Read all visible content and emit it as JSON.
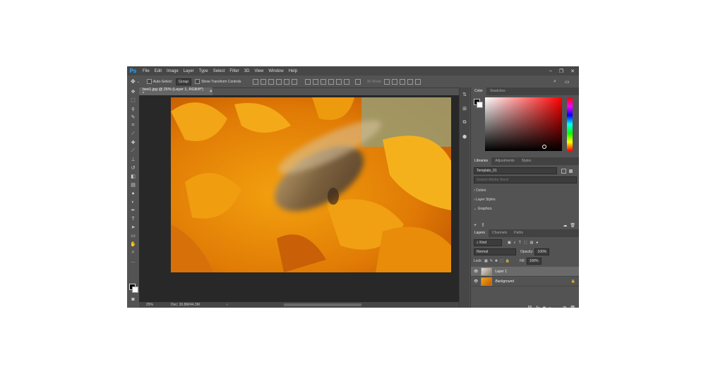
{
  "app": {
    "logo": "Ps"
  },
  "menu": [
    "File",
    "Edit",
    "Image",
    "Layer",
    "Type",
    "Select",
    "Filter",
    "3D",
    "View",
    "Window",
    "Help"
  ],
  "window_controls": [
    "minimize-icon",
    "restore-icon",
    "close-icon"
  ],
  "options": {
    "auto_select_label": "Auto-Select:",
    "auto_select_value": "Group",
    "show_transform_label": "Show Transform Controls",
    "mode_3d_label": "3D Mode:"
  },
  "document": {
    "tab_title": "bee1.jpg @ 25% (Layer 1, RGB/8*) *",
    "zoom": "25%",
    "doc_info": "Doc: 30.8M/44.3M"
  },
  "color_panel": {
    "tabs": [
      "Color",
      "Swatches"
    ]
  },
  "libraries_panel": {
    "tabs": [
      "Libraries",
      "Adjustments",
      "Styles"
    ],
    "library_name": "Template_01",
    "search_placeholder": "Search Adobe Stock",
    "sections": [
      "Colors",
      "Layer Styles",
      "Graphics"
    ]
  },
  "layers_panel": {
    "tabs": [
      "Layers",
      "Channels",
      "Paths"
    ],
    "filter_kind": "Kind",
    "blend_mode": "Normal",
    "opacity_label": "Opacity:",
    "opacity_value": "100%",
    "lock_label": "Lock:",
    "fill_label": "Fill:",
    "fill_value": "100%",
    "layers": [
      {
        "name": "Layer 1",
        "selected": true
      },
      {
        "name": "Background",
        "selected": false
      }
    ]
  },
  "colors": {
    "accent": "#31a8ff",
    "panel": "#535353",
    "dark": "#282828"
  }
}
